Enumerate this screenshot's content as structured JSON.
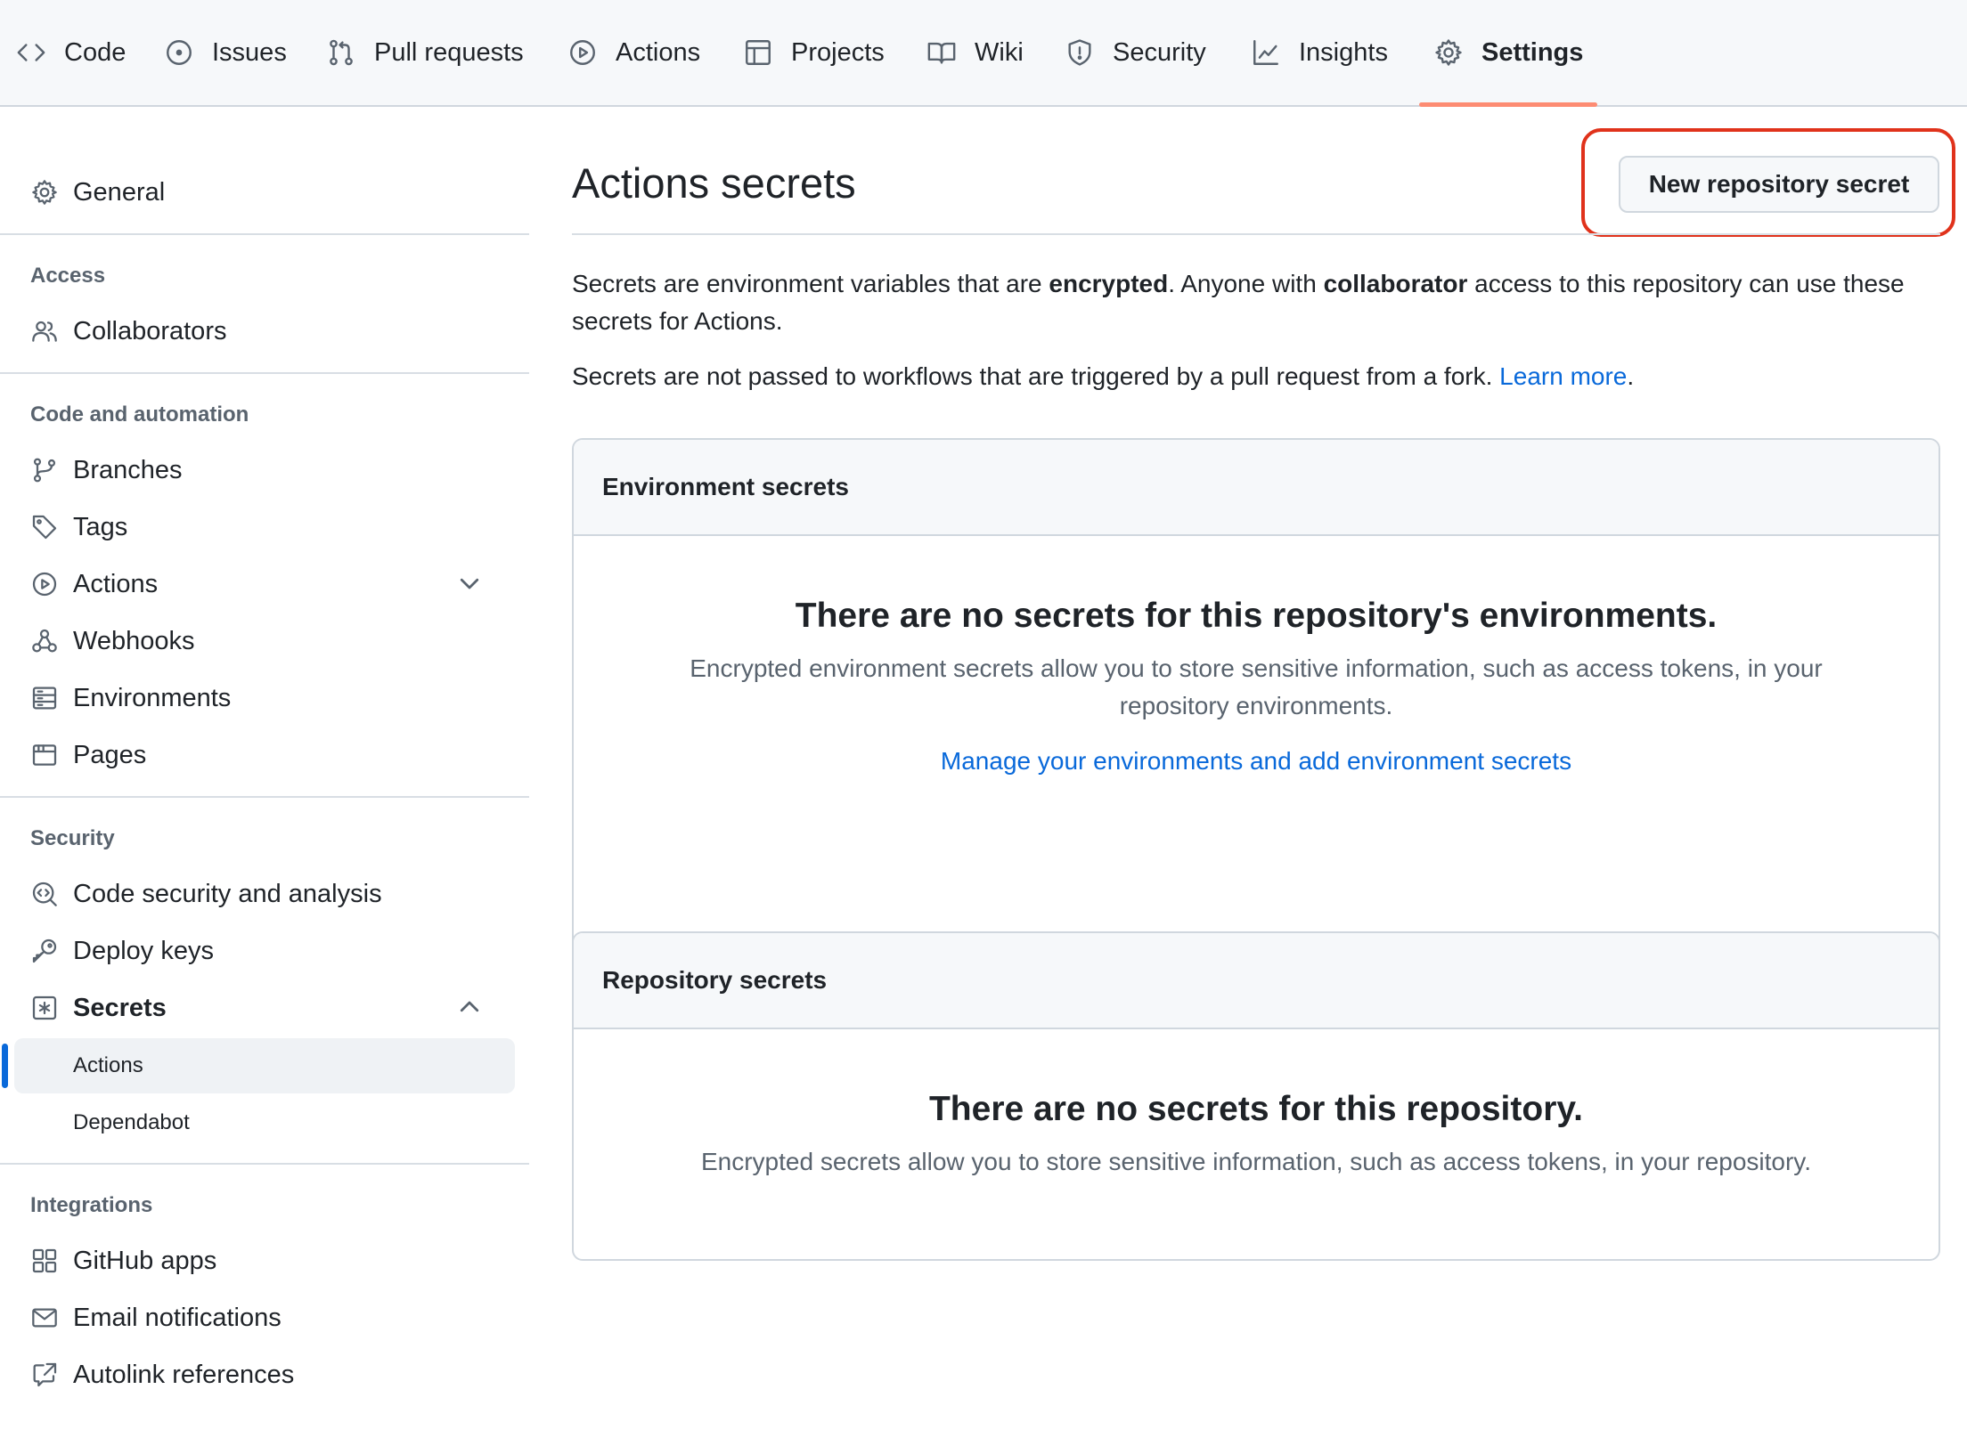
{
  "repo_nav": {
    "tabs": [
      {
        "label": "Code",
        "icon": "code-icon"
      },
      {
        "label": "Issues",
        "icon": "issue-opened-icon"
      },
      {
        "label": "Pull requests",
        "icon": "git-pull-request-icon"
      },
      {
        "label": "Actions",
        "icon": "play-icon"
      },
      {
        "label": "Projects",
        "icon": "table-icon"
      },
      {
        "label": "Wiki",
        "icon": "book-icon"
      },
      {
        "label": "Security",
        "icon": "shield-icon"
      },
      {
        "label": "Insights",
        "icon": "graph-icon"
      },
      {
        "label": "Settings",
        "icon": "gear-icon",
        "active": true
      }
    ]
  },
  "sidebar": {
    "general": "General",
    "access_heading": "Access",
    "collaborators": "Collaborators",
    "code_heading": "Code and automation",
    "branches": "Branches",
    "tags": "Tags",
    "actions": "Actions",
    "webhooks": "Webhooks",
    "environments": "Environments",
    "pages": "Pages",
    "security_heading": "Security",
    "code_security": "Code security and analysis",
    "deploy_keys": "Deploy keys",
    "secrets": "Secrets",
    "secrets_actions": "Actions",
    "secrets_dependabot": "Dependabot",
    "integrations_heading": "Integrations",
    "github_apps": "GitHub apps",
    "email_notifications": "Email notifications",
    "autolink_references": "Autolink references"
  },
  "main": {
    "title": "Actions secrets",
    "new_secret_button": "New repository secret",
    "desc1": {
      "part1": "Secrets are environment variables that are ",
      "bold1": "encrypted",
      "part2": ". Anyone with ",
      "bold2": "collaborator",
      "part3": " access to this repository can use these secrets for Actions."
    },
    "desc2": {
      "text": "Secrets are not passed to workflows that are triggered by a pull request from a fork. ",
      "link": "Learn more",
      "end": "."
    },
    "environment_secrets": {
      "header": "Environment secrets",
      "blank_title": "There are no secrets for this repository's environments.",
      "blank_text": "Encrypted environment secrets allow you to store sensitive information, such as access tokens, in your repository environments.",
      "link": "Manage your environments and add environment secrets"
    },
    "repository_secrets": {
      "header": "Repository secrets",
      "blank_title": "There are no secrets for this repository.",
      "blank_text": "Encrypted secrets allow you to store sensitive information, such as access tokens, in your repository."
    }
  },
  "colors": {
    "link": "#0969da",
    "active_tab_underline": "#fd8c73",
    "highlight_box": "#e0321b",
    "selected_indicator": "#0969da"
  }
}
